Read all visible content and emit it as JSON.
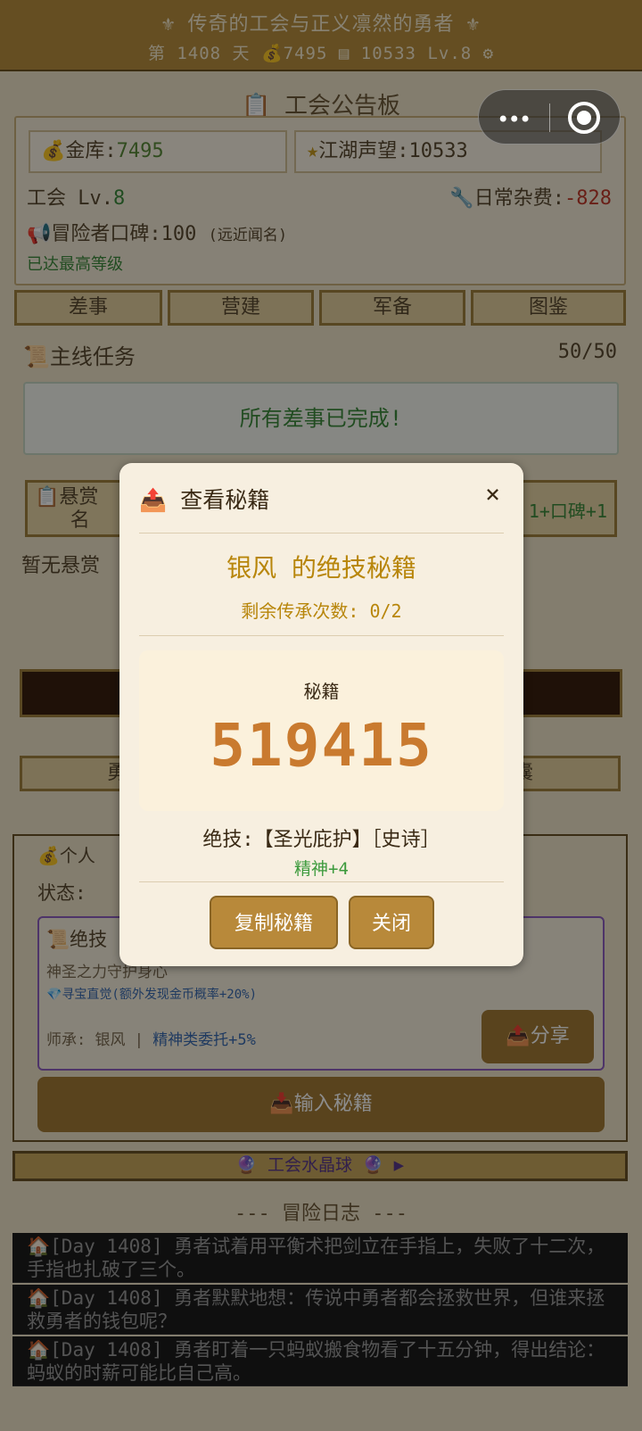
{
  "header": {
    "title": "传奇的工会与正义凛然的勇者",
    "day_label": "第 1408 天",
    "gold": "7495",
    "reputation": "10533",
    "level": "Lv.8"
  },
  "board": {
    "title": "工会公告板",
    "treasury_label": "金库:",
    "treasury_value": "7495",
    "fame_label": "江湖声望:",
    "fame_value": "10533",
    "guild_level_label": "工会 Lv.",
    "guild_level_value": "8",
    "expense_label": "日常杂费:",
    "expense_value": "-828",
    "praise": "冒险者口碑:100",
    "praise_note": "(远近闻名)",
    "max_level": "已达最高等级"
  },
  "tabs": [
    "差事",
    "营建",
    "军备",
    "图鉴"
  ],
  "main_quest": {
    "label": "主线任务",
    "progress": "50/50",
    "done_text": "所有差事已完成!"
  },
  "bounty": {
    "label_line1": "悬赏",
    "label_line2": "名",
    "right": "1+口碑+1",
    "empty": "暂无悬赏"
  },
  "bottom_tabs": {
    "left": "勇者",
    "right": "行囊"
  },
  "personal": {
    "title": "个人",
    "status_label": "状态:",
    "skill_label": "绝技",
    "desc": "神圣之力守护身心",
    "buff": "寻宝直觉(额外发现金币概率+20%)",
    "master": "师承: 银风 | ",
    "master_bonus": "精神类委托+5%",
    "share": "分享",
    "input": "输入秘籍"
  },
  "crystal": "工会水晶球",
  "log": {
    "title": "--- 冒险日志 ---",
    "entries": [
      "[Day 1408] 勇者试着用平衡术把剑立在手指上，失败了十二次，手指也扎破了三个。",
      "[Day 1408] 勇者默默地想：传说中勇者都会拯救世界，但谁来拯救勇者的钱包呢？",
      "[Day 1408] 勇者盯着一只蚂蚁搬食物看了十五分钟，得出结论：蚂蚁的时薪可能比自己高。"
    ]
  },
  "modal": {
    "title": "查看秘籍",
    "close": "×",
    "owner_line": "银风 的绝技秘籍",
    "remaining": "剩余传承次数: 0/2",
    "code_label": "秘籍",
    "code": "519415",
    "skill": "绝技:【圣光庇护】［史诗］",
    "stat": "精神+4",
    "copy_button": "复制秘籍",
    "close_button": "关闭"
  }
}
